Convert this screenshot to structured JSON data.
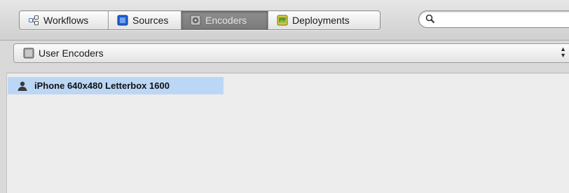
{
  "toolbar": {
    "tabs": [
      {
        "label": "Workflows",
        "icon": "workflow-icon"
      },
      {
        "label": "Sources",
        "icon": "sources-icon"
      },
      {
        "label": "Encoders",
        "icon": "encoders-icon",
        "active": true
      },
      {
        "label": "Deployments",
        "icon": "deployments-icon"
      }
    ],
    "search": {
      "value": "",
      "placeholder": ""
    }
  },
  "filter": {
    "selected": "User Encoders",
    "icon": "encoder-group-icon"
  },
  "list": {
    "items": [
      {
        "label": "iPhone 640x480 Letterbox 1600",
        "icon": "user-icon",
        "selected": true
      }
    ]
  },
  "colors": {
    "selection": "#bcd6f5",
    "active_tab": "#858585",
    "sources_blue": "#1f5fd6",
    "deployments_green": "#5a9a2a"
  }
}
